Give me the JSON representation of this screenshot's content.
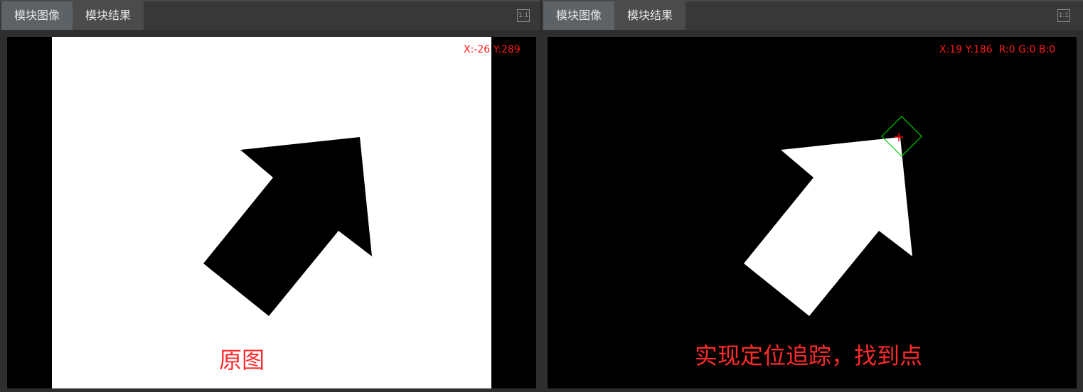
{
  "left_panel": {
    "tabs": [
      "模块图像",
      "模块结果"
    ],
    "fit_label": "1:1",
    "readout": "X:-26 Y:289",
    "caption": "原图"
  },
  "right_panel": {
    "tabs": [
      "模块图像",
      "模块结果"
    ],
    "fit_label": "1:1",
    "readout": "X:19 Y:186  R:0 G:0 B:0",
    "caption": "实现定位追踪，找到点"
  },
  "colors": {
    "readout": "#ff1a1a",
    "caption": "#ff2a2a",
    "marker_box": "#00cc00",
    "marker_cross": "#ff0000"
  }
}
